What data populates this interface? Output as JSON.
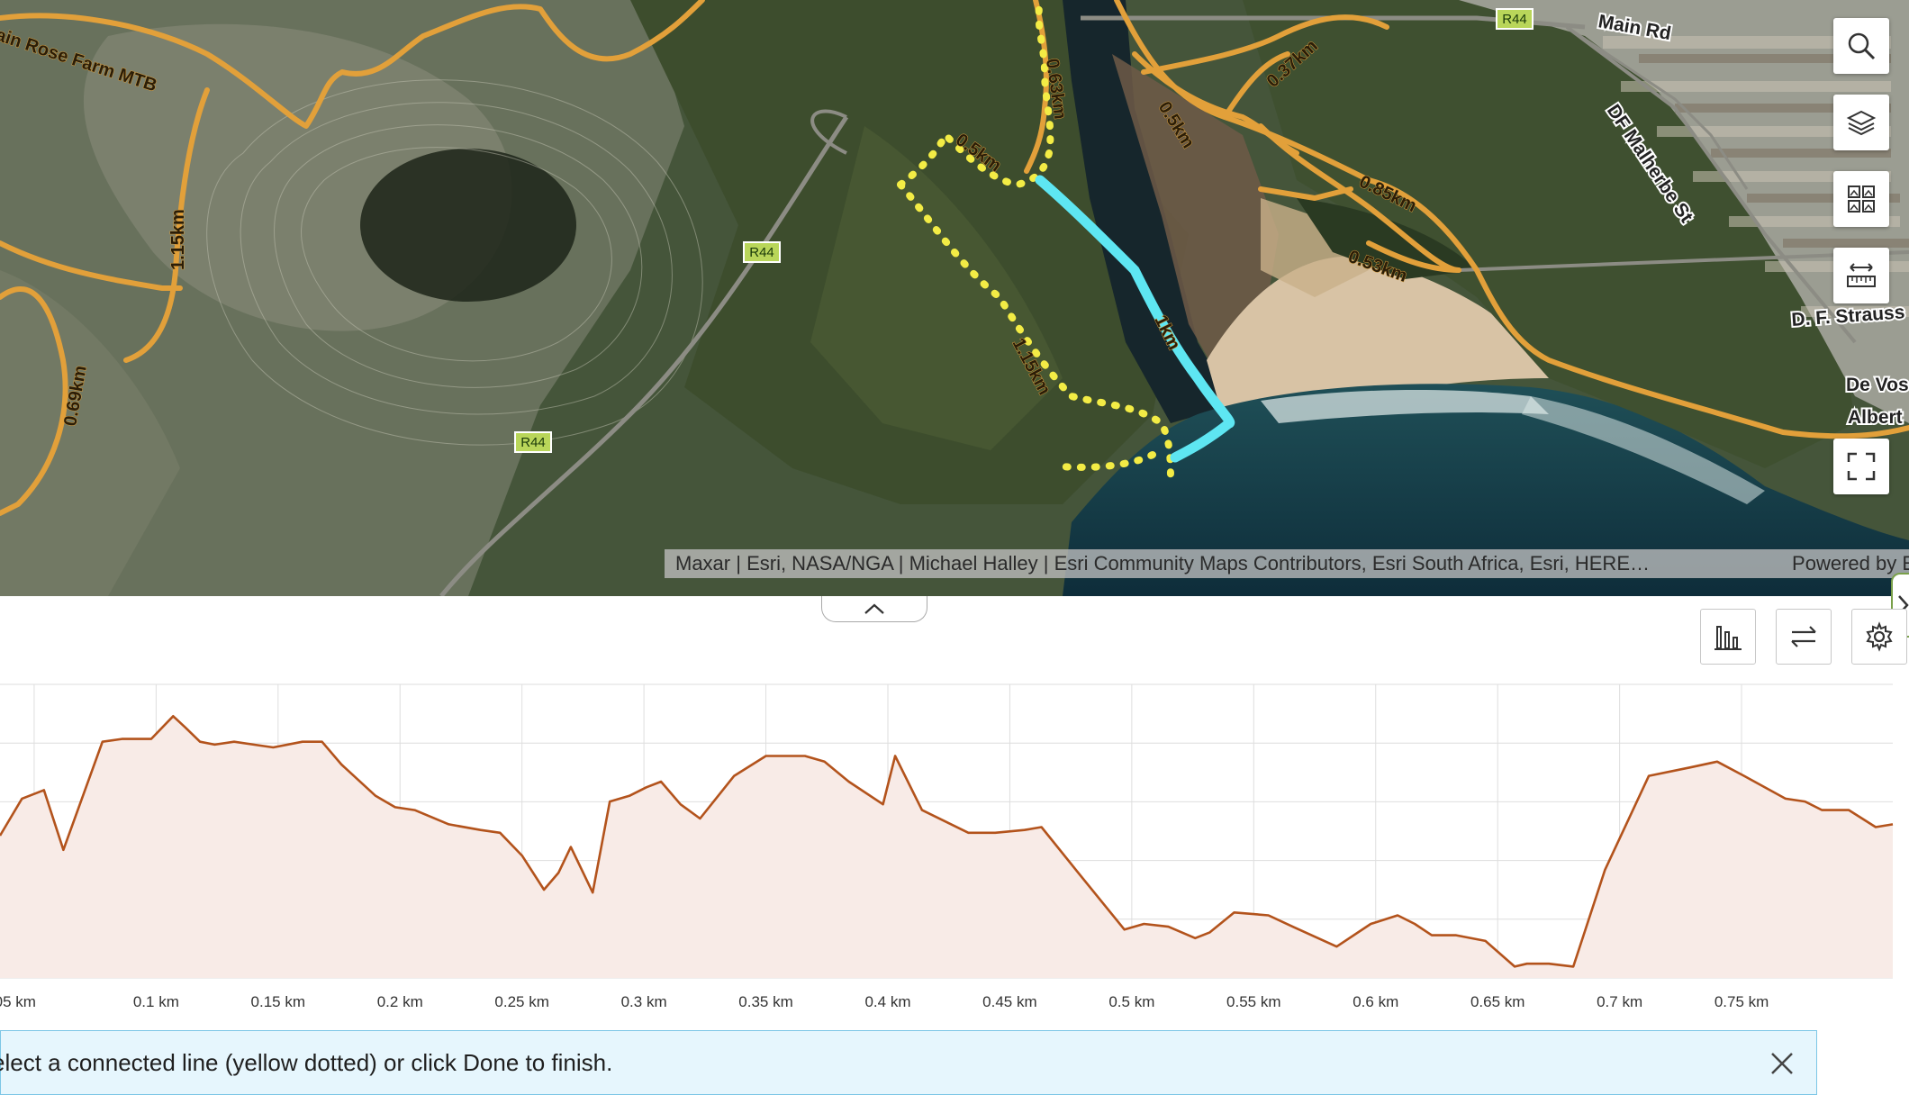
{
  "map": {
    "trail_labels": {
      "rose_farm": "ain Rose Farm MTB",
      "d1": "1.15km",
      "d2": "0.69km",
      "d3": "0.63km",
      "d4": "0.5km",
      "d5": "0.5km",
      "d6": "0.37km",
      "d7": "0.85km",
      "d8": "0.53km",
      "d9": "1.15km",
      "d10": "1km"
    },
    "road_labels": {
      "main_rd": "Main Rd",
      "df_malherbe": "DF Malherbe St",
      "df_strauss": "D. F. Strauss",
      "de_vos": "De Vos",
      "albert": "Albert",
      "r44_a": "R44",
      "r44_b": "R44",
      "r44_c": "R44"
    },
    "attribution_left": "Maxar | Esri, NASA/NGA | Michael Halley | Esri Community Maps Contributors, Esri South Africa, Esri, HERE…",
    "attribution_right": "Powered by Es",
    "tools": {
      "search": "search-icon",
      "layers": "layers-icon",
      "basemap": "basemap-gallery-icon",
      "measure": "measure-icon",
      "fullscreen": "fullscreen-icon"
    }
  },
  "profile": {
    "toolbar": {
      "chart": "bar-chart-icon",
      "flip": "flip-arrows-icon",
      "settings": "gear-icon"
    }
  },
  "hint": {
    "text": "elect a connected line (yellow dotted) or click Done to finish.",
    "close": "close-icon"
  },
  "colors": {
    "trail": "#e2a03a",
    "selected_line": "#5ee6f2",
    "connected_line": "#f3ec45",
    "profile_line": "#b3531c",
    "profile_fill": "#f8ebe7",
    "hint_bg": "#e6f6fd"
  },
  "chart_data": {
    "type": "area",
    "title": "",
    "xlabel": "",
    "ylabel": "",
    "x_unit": "km",
    "xlim": [
      0.036,
      0.812
    ],
    "ylim": [
      0,
      100
    ],
    "grid": true,
    "x_ticks": [
      {
        "value": 0.05,
        "label": "05 km"
      },
      {
        "value": 0.1,
        "label": "0.1 km"
      },
      {
        "value": 0.15,
        "label": "0.15 km"
      },
      {
        "value": 0.2,
        "label": "0.2 km"
      },
      {
        "value": 0.25,
        "label": "0.25 km"
      },
      {
        "value": 0.3,
        "label": "0.3 km"
      },
      {
        "value": 0.35,
        "label": "0.35 km"
      },
      {
        "value": 0.4,
        "label": "0.4 km"
      },
      {
        "value": 0.45,
        "label": "0.45 km"
      },
      {
        "value": 0.5,
        "label": "0.5 km"
      },
      {
        "value": 0.55,
        "label": "0.55 km"
      },
      {
        "value": 0.6,
        "label": "0.6 km"
      },
      {
        "value": 0.65,
        "label": "0.65 km"
      },
      {
        "value": 0.7,
        "label": "0.7 km"
      },
      {
        "value": 0.75,
        "label": "0.75 km"
      }
    ],
    "series": [
      {
        "x": [
          0.036,
          0.045,
          0.054,
          0.062,
          0.078,
          0.086,
          0.098,
          0.107,
          0.112,
          0.118,
          0.124,
          0.132,
          0.14,
          0.148,
          0.16,
          0.168,
          0.176,
          0.19,
          0.198,
          0.206,
          0.22,
          0.233,
          0.241,
          0.25,
          0.259,
          0.265,
          0.27,
          0.279,
          0.286,
          0.294,
          0.301,
          0.307,
          0.315,
          0.323,
          0.337,
          0.35,
          0.358,
          0.366,
          0.374,
          0.384,
          0.398,
          0.403,
          0.414,
          0.433,
          0.444,
          0.456,
          0.463,
          0.478,
          0.497,
          0.505,
          0.515,
          0.526,
          0.532,
          0.542,
          0.556,
          0.566,
          0.584,
          0.598,
          0.609,
          0.616,
          0.623,
          0.633,
          0.645,
          0.657,
          0.662,
          0.671,
          0.681,
          0.694,
          0.712,
          0.729,
          0.74,
          0.751,
          0.768,
          0.776,
          0.783,
          0.794,
          0.805,
          0.812
        ],
        "y": [
          50,
          63,
          66,
          45,
          83,
          84,
          84,
          92,
          88,
          83,
          82,
          83,
          82,
          81,
          83,
          83,
          75,
          64,
          60,
          59,
          54,
          52,
          51,
          43,
          31,
          37,
          46,
          30,
          62,
          64,
          67,
          69,
          61,
          56,
          71,
          78,
          78,
          78,
          76,
          69,
          61,
          78,
          59,
          51,
          51,
          52,
          53,
          37,
          17,
          19,
          18,
          14,
          16,
          23,
          22,
          18,
          11,
          19,
          22,
          19,
          15,
          15,
          13,
          4,
          5,
          5,
          4,
          38,
          71,
          74,
          76,
          71,
          63,
          62,
          59,
          59,
          53,
          54
        ]
      }
    ]
  }
}
